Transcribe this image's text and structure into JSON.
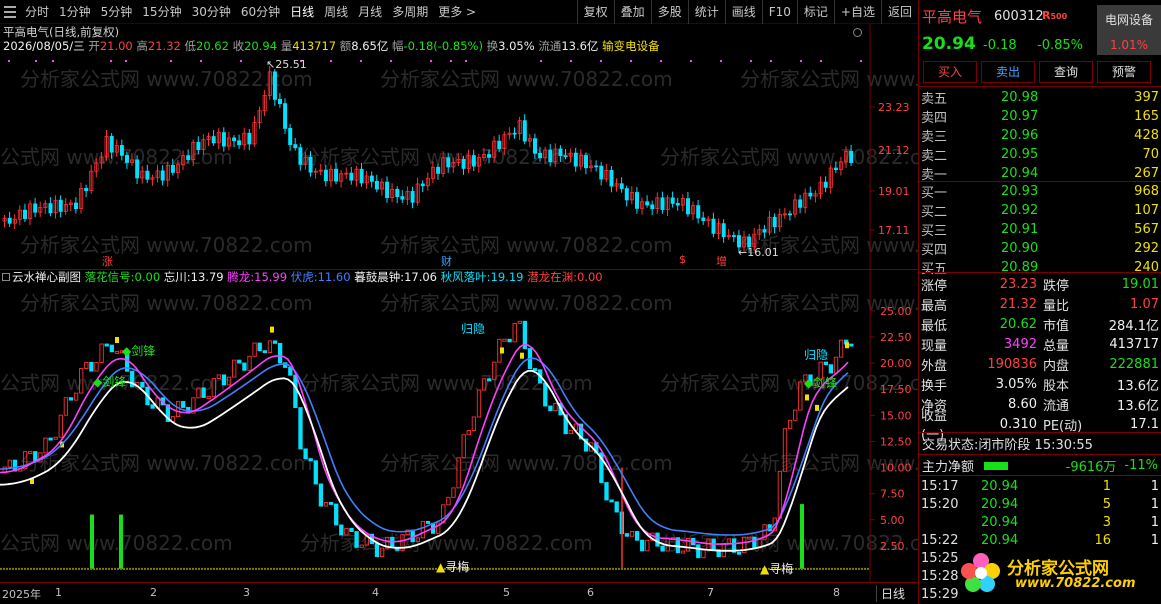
{
  "toolbar": {
    "periods": [
      "分时",
      "1分钟",
      "5分钟",
      "15分钟",
      "30分钟",
      "60分钟",
      "日线",
      "周线",
      "月线",
      "多周期",
      "更多 >"
    ],
    "tools": [
      "复权",
      "叠加",
      "多股",
      "统计",
      "画线",
      "F10",
      "标记",
      "+自选",
      "返回"
    ]
  },
  "main": {
    "title": "平高电气(日线,前复权)",
    "info": {
      "date": "2026/08/05/三",
      "open_label": "开",
      "open": "21.00",
      "high_label": "高",
      "high": "21.32",
      "low_label": "低",
      "low": "20.62",
      "close_label": "收",
      "close": "20.94",
      "vol_label": "量",
      "vol": "413717",
      "amt_label": "额",
      "amt": "8.65亿",
      "chg_label": "幅",
      "chg": "-0.18(-0.85%)",
      "turn_label": "换",
      "turn": "3.05%",
      "float_label": "流通",
      "float": "13.6亿",
      "sector": "输变电设备"
    },
    "y_ticks": [
      "23.23",
      "21.12",
      "19.01",
      "17.11"
    ],
    "peak_label": "25.51",
    "low_label": "16.01",
    "markers": [
      "涨",
      "财",
      "$",
      "增"
    ]
  },
  "sub": {
    "title": "云水禅心副图",
    "legend": [
      {
        "name": "落花信号:",
        "value": "0.00",
        "color": "#18e018"
      },
      {
        "name": "忘川:",
        "value": "13.79",
        "color": "#f0f0f0"
      },
      {
        "name": "腾龙:",
        "value": "15.99",
        "color": "#ff40ff"
      },
      {
        "name": "伏虎:",
        "value": "11.60",
        "color": "#4080ff"
      },
      {
        "name": "暮鼓晨钟:",
        "value": "17.06",
        "color": "#f0f0f0"
      },
      {
        "name": "秋风落叶:",
        "value": "19.19",
        "color": "#00e0ff"
      },
      {
        "name": "潜龙在渊:",
        "value": "0.00",
        "color": "#ff4040"
      }
    ],
    "y_ticks": [
      "25.00",
      "22.50",
      "20.00",
      "17.50",
      "15.00",
      "12.50",
      "10.00",
      "7.50",
      "5.00",
      "2.50"
    ],
    "annotations": {
      "guiyin": "归隐",
      "jianfeng": "剑锋",
      "xunmei": "寻梅"
    }
  },
  "axis": {
    "labels": [
      "2025年",
      "1",
      "2",
      "3",
      "4",
      "5",
      "6",
      "7",
      "8"
    ],
    "period": "日线"
  },
  "quote": {
    "name": "平高电气",
    "code": "600312",
    "badge": "R",
    "badge2": "500",
    "sector": "电网设备",
    "sector_chg": "1.01%",
    "price": "20.94",
    "chg": "-0.18",
    "pct": "-0.85%",
    "buttons": [
      "买入",
      "卖出",
      "查询",
      "预警"
    ]
  },
  "orderbook": {
    "asks": [
      {
        "label": "卖五",
        "price": "20.98",
        "vol": "397"
      },
      {
        "label": "卖四",
        "price": "20.97",
        "vol": "165"
      },
      {
        "label": "卖三",
        "price": "20.96",
        "vol": "428"
      },
      {
        "label": "卖二",
        "price": "20.95",
        "vol": "70"
      },
      {
        "label": "卖一",
        "price": "20.94",
        "vol": "267"
      }
    ],
    "bids": [
      {
        "label": "买一",
        "price": "20.93",
        "vol": "968"
      },
      {
        "label": "买二",
        "price": "20.92",
        "vol": "107"
      },
      {
        "label": "买三",
        "price": "20.91",
        "vol": "567"
      },
      {
        "label": "买四",
        "price": "20.90",
        "vol": "292"
      },
      {
        "label": "买五",
        "price": "20.89",
        "vol": "240"
      }
    ]
  },
  "stats": [
    {
      "l1": "涨停",
      "v1": "23.23",
      "c1": "red",
      "l2": "跌停",
      "v2": "19.01",
      "c2": "green"
    },
    {
      "l1": "最高",
      "v1": "21.32",
      "c1": "red",
      "l2": "量比",
      "v2": "1.07",
      "c2": "red"
    },
    {
      "l1": "最低",
      "v1": "20.62",
      "c1": "green",
      "l2": "市值",
      "v2": "284.1亿",
      "c2": "white"
    },
    {
      "l1": "现量",
      "v1": "3492",
      "c1": "magenta",
      "l2": "总量",
      "v2": "413717",
      "c2": "white"
    },
    {
      "l1": "外盘",
      "v1": "190836",
      "c1": "red",
      "l2": "内盘",
      "v2": "222881",
      "c2": "green"
    },
    {
      "l1": "换手",
      "v1": "3.05%",
      "c1": "white",
      "l2": "股本",
      "v2": "13.6亿",
      "c2": "white"
    },
    {
      "l1": "净资",
      "v1": "8.60",
      "c1": "white",
      "l2": "流通",
      "v2": "13.6亿",
      "c2": "white"
    },
    {
      "l1": "收益(一)",
      "v1": "0.310",
      "c1": "white",
      "l2": "PE(动)",
      "v2": "17.1",
      "c2": "white"
    }
  ],
  "trade_state": {
    "label": "交易状态:",
    "value": "闭市阶段",
    "time": "15:30:55"
  },
  "netflow": {
    "label": "主力净额",
    "value": "-9616万",
    "pct": "-11%"
  },
  "ticks": [
    {
      "t": "15:17",
      "p": "20.94",
      "v": "1",
      "n": "1"
    },
    {
      "t": "15:20",
      "p": "20.94",
      "v": "5",
      "n": "1"
    },
    {
      "t": "",
      "p": "20.94",
      "v": "3",
      "n": "1"
    },
    {
      "t": "15:22",
      "p": "20.94",
      "v": "16",
      "n": "1"
    },
    {
      "t": "15:25",
      "p": "",
      "v": "",
      "n": ""
    },
    {
      "t": "15:28",
      "p": "",
      "v": "",
      "n": ""
    },
    {
      "t": "15:29",
      "p": "",
      "v": "",
      "n": ""
    }
  ],
  "watermark": {
    "brand": "分析家公式网",
    "url": "www.70822.com"
  },
  "colors": {
    "up": "#ff3030",
    "down": "#00e0ff",
    "ma_white": "#ffffff",
    "ma_magenta": "#ff40ff",
    "ma_blue": "#4080ff",
    "volume": "#18e018",
    "yellow": "#f0e000"
  }
}
